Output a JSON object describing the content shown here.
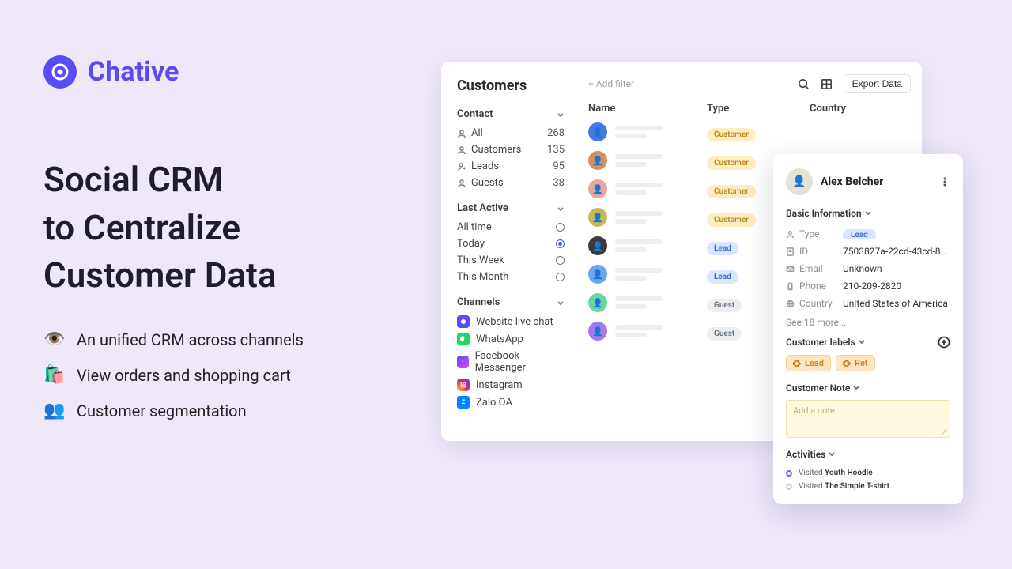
{
  "brand": {
    "name": "Chative"
  },
  "hero": {
    "title_line1": "Social CRM",
    "title_line2": "to Centralize",
    "title_line3": "Customer Data",
    "bullets": {
      "b1": "An unified CRM across channels",
      "b2": "View orders and shopping cart",
      "b3": "Customer segmentation"
    }
  },
  "crm": {
    "sidebar": {
      "title": "Customers",
      "contact_section": "Contact",
      "contacts": [
        {
          "label": "All",
          "count": "268"
        },
        {
          "label": "Customers",
          "count": "135"
        },
        {
          "label": "Leads",
          "count": "95"
        },
        {
          "label": "Guests",
          "count": "38"
        }
      ],
      "last_active_section": "Last Active",
      "last_active": [
        {
          "label": "All time",
          "selected": false
        },
        {
          "label": "Today",
          "selected": true
        },
        {
          "label": "This Week",
          "selected": false
        },
        {
          "label": "This Month",
          "selected": false
        }
      ],
      "channels_section": "Channels",
      "channels": [
        {
          "label": "Website live chat",
          "icon": "website"
        },
        {
          "label": "WhatsApp",
          "icon": "whatsapp"
        },
        {
          "label": "Facebook Messenger",
          "icon": "fbm"
        },
        {
          "label": "Instagram",
          "icon": "ig"
        },
        {
          "label": "Zalo OA",
          "icon": "zalo"
        }
      ]
    },
    "toolbar": {
      "add_filter": "+ Add filter",
      "export": "Export Data"
    },
    "columns": {
      "name": "Name",
      "type": "Type",
      "country": "Country"
    },
    "type_labels": {
      "customer": "Customer",
      "lead": "Lead",
      "guest": "Guest"
    },
    "rows": [
      {
        "type": "customer",
        "av": "#4678e5"
      },
      {
        "type": "customer",
        "av": "#d68f5e"
      },
      {
        "type": "customer",
        "av": "#e8a5a1"
      },
      {
        "type": "customer",
        "av": "#c7b956"
      },
      {
        "type": "lead",
        "av": "#3b3b3b"
      },
      {
        "type": "lead",
        "av": "#6aa7f0"
      },
      {
        "type": "guest",
        "av": "#6cd6a2"
      },
      {
        "type": "guest",
        "av": "#a777f0"
      }
    ]
  },
  "detail": {
    "name": "Alex Belcher",
    "sections": {
      "basic": "Basic Information",
      "labels": "Customer labels",
      "note": "Customer Note",
      "activities": "Activities"
    },
    "info": {
      "type_key": "Type",
      "type_val": "Lead",
      "id_key": "ID",
      "id_val": "7503827a-22cd-43cd-8...",
      "email_key": "Email",
      "email_val": "Unknown",
      "phone_key": "Phone",
      "phone_val": "210-209-2820",
      "country_key": "Country",
      "country_val": "United States of America"
    },
    "see_more": "See 18 more...",
    "label_chips": {
      "c0": "Lead",
      "c1": "Ret"
    },
    "note_placeholder": "Add a note...",
    "activities": {
      "a0_verb": "Visited ",
      "a0_obj": "Youth Hoodie",
      "a1_verb": "Visited ",
      "a1_obj": "The Simple T-shirt"
    }
  }
}
